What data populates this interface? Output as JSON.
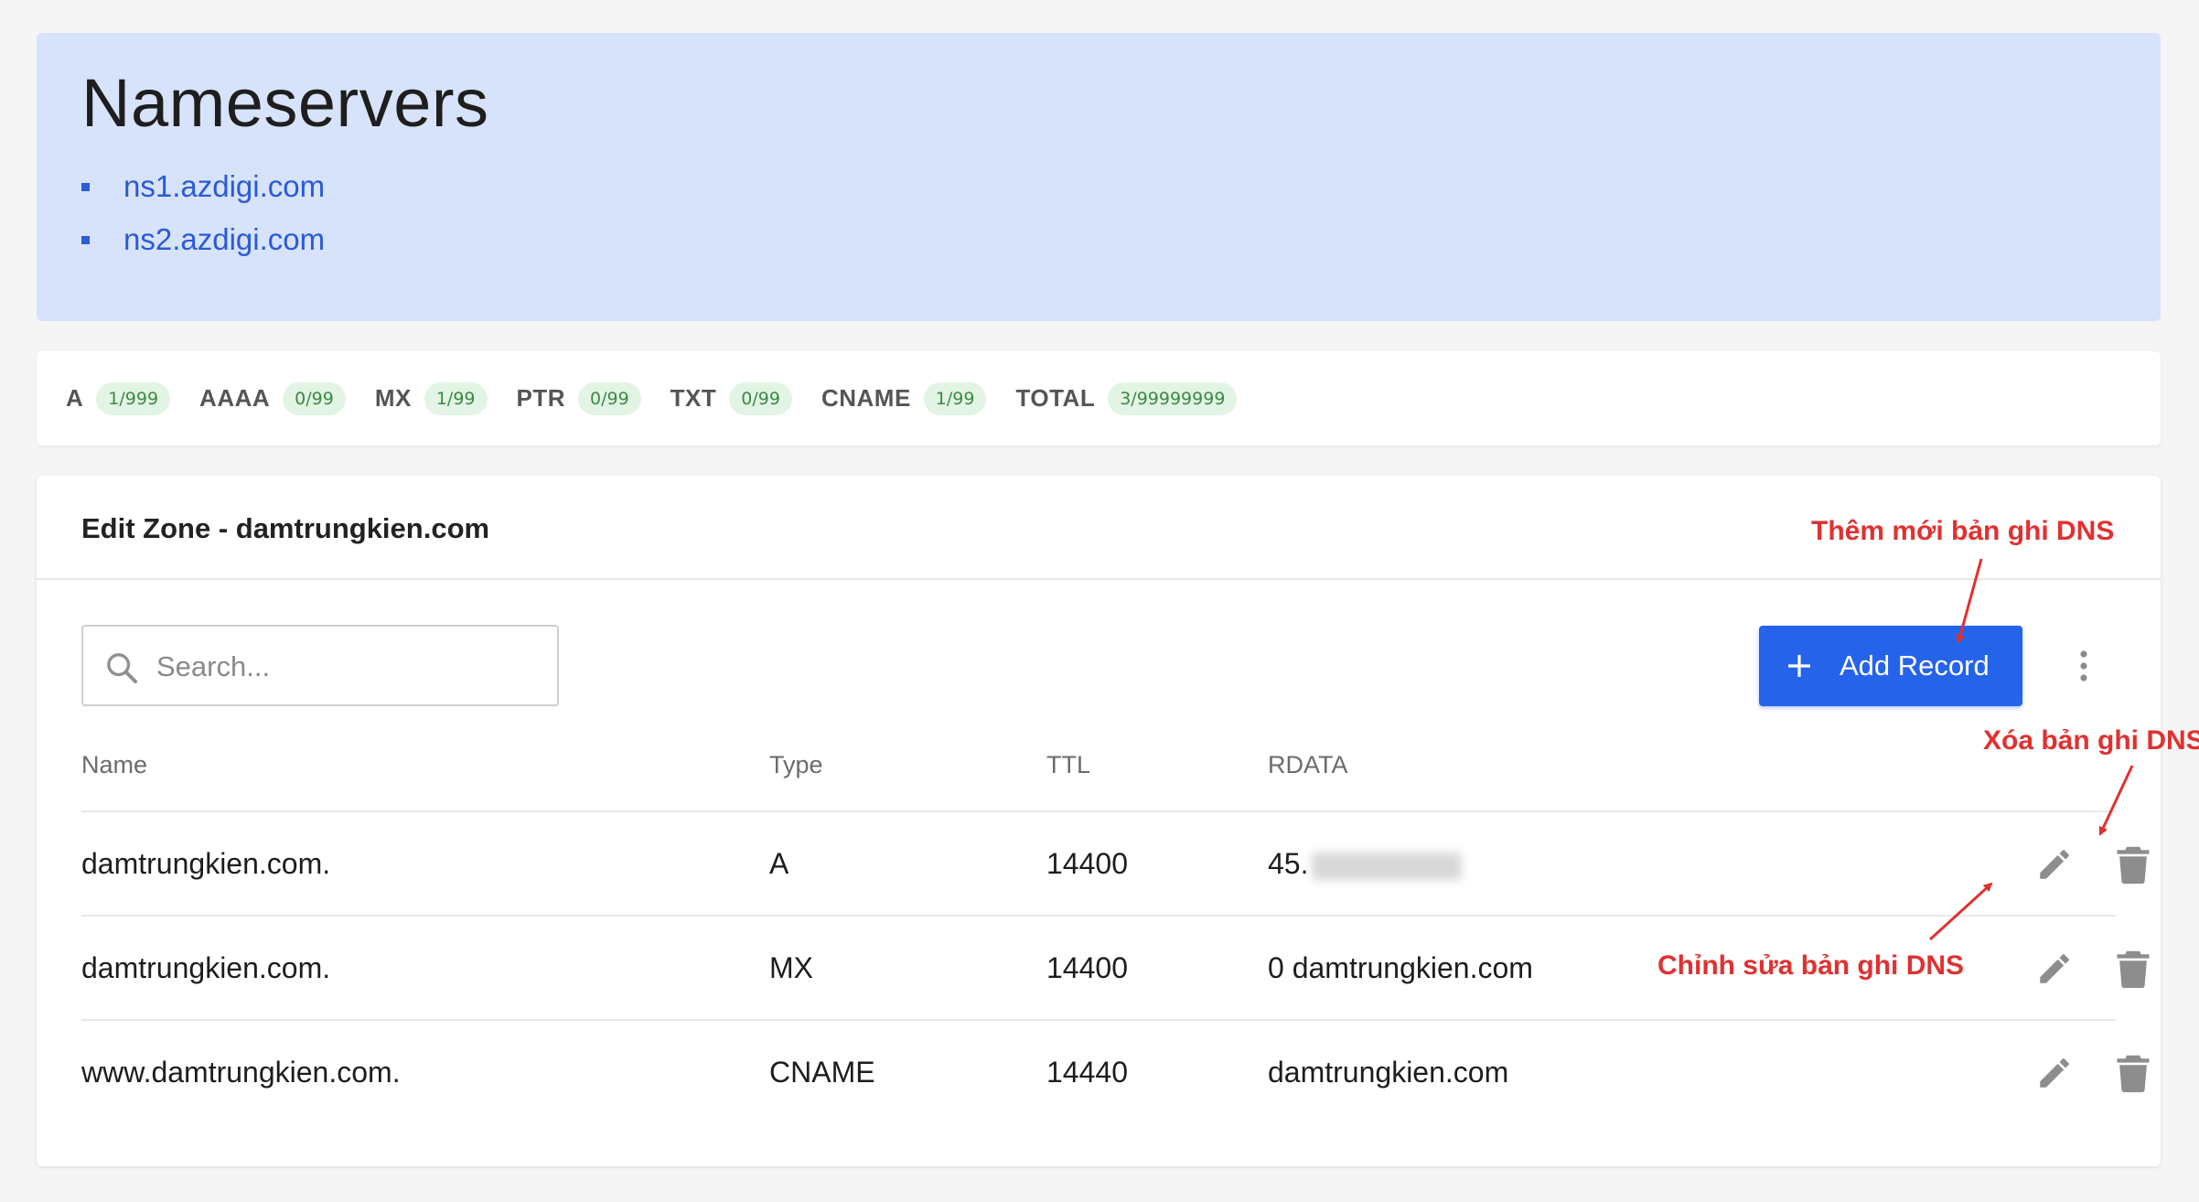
{
  "nameservers": {
    "title": "Nameservers",
    "items": [
      "ns1.azdigi.com",
      "ns2.azdigi.com"
    ]
  },
  "quota": [
    {
      "label": "A",
      "badge": "1/999"
    },
    {
      "label": "AAAA",
      "badge": "0/99"
    },
    {
      "label": "MX",
      "badge": "1/99"
    },
    {
      "label": "PTR",
      "badge": "0/99"
    },
    {
      "label": "TXT",
      "badge": "0/99"
    },
    {
      "label": "CNAME",
      "badge": "1/99"
    },
    {
      "label": "TOTAL",
      "badge": "3/99999999"
    }
  ],
  "zone": {
    "title": "Edit Zone - damtrungkien.com",
    "search_placeholder": "Search...",
    "add_label": "Add Record",
    "columns": {
      "name": "Name",
      "type": "Type",
      "ttl": "TTL",
      "rdata": "RDATA"
    },
    "records": [
      {
        "name": "damtrungkien.com.",
        "type": "A",
        "ttl": "14400",
        "rdata": "45."
      },
      {
        "name": "damtrungkien.com.",
        "type": "MX",
        "ttl": "14400",
        "rdata": "0 damtrungkien.com"
      },
      {
        "name": "www.damtrungkien.com.",
        "type": "CNAME",
        "ttl": "14440",
        "rdata": "damtrungkien.com"
      }
    ]
  },
  "annotations": {
    "add": "Thêm mới bản ghi DNS",
    "delete": "Xóa bản ghi DNS",
    "edit": "Chỉnh sửa bản ghi DNS"
  },
  "colors": {
    "accent": "#2563eb",
    "nameserver_panel": "#d7e3fa",
    "badge_bg": "#e2f4e4",
    "badge_text": "#3b8a45",
    "annotation": "#e03131"
  }
}
